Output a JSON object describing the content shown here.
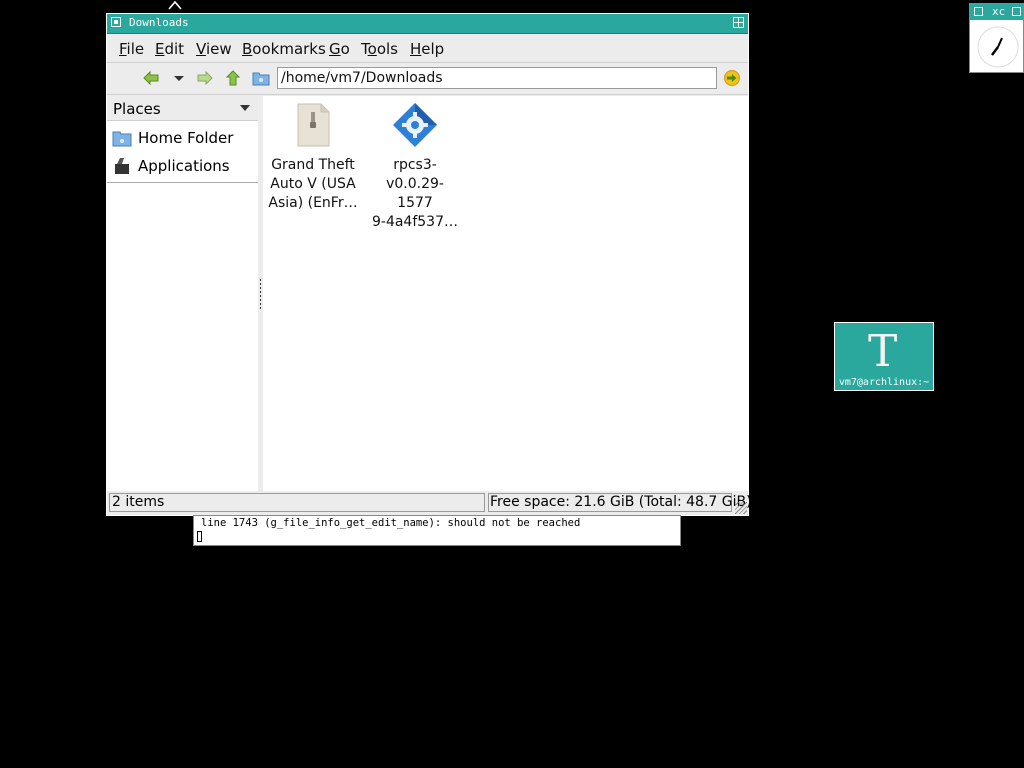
{
  "window": {
    "title": "Downloads"
  },
  "menubar": {
    "items": [
      "File",
      "Edit",
      "View",
      "Bookmarks",
      "Go",
      "Tools",
      "Help"
    ],
    "mnemonics": [
      "F",
      "E",
      "V",
      "B",
      "G",
      "o",
      "H"
    ]
  },
  "toolbar": {
    "location": "/home/vm7/Downloads",
    "icons": [
      "back-arrow-icon",
      "history-dropdown-icon",
      "forward-arrow-icon",
      "up-arrow-icon",
      "folder-icon",
      "go-arrow-icon"
    ]
  },
  "sidebar": {
    "header": "Places",
    "items": [
      {
        "label": "Home Folder",
        "icon": "home-folder-icon"
      },
      {
        "label": "Applications",
        "icon": "applications-icon"
      }
    ]
  },
  "files": [
    {
      "name_lines": [
        "Grand Theft",
        "Auto V (USA",
        "Asia) (EnFr…"
      ],
      "icon": "archive-file-icon"
    },
    {
      "name_lines": [
        "rpcs3-",
        "v0.0.29-1577",
        "9-4a4f537…"
      ],
      "icon": "rpcs3-gear-icon"
    }
  ],
  "statusbar": {
    "count": "2 items",
    "free_space": "Free space: 21.6 GiB (Total: 48.7 GiB)"
  },
  "terminal_error": {
    "text": " line 1743 (g_file_info_get_edit_name): should not be reached"
  },
  "mini_window": {
    "title": "xc"
  },
  "iconified_terminal": {
    "glyph": "T",
    "label": "vm7@archlinux:~"
  },
  "colors": {
    "titlebar": "#2aa89e",
    "desktop": "#000000"
  }
}
